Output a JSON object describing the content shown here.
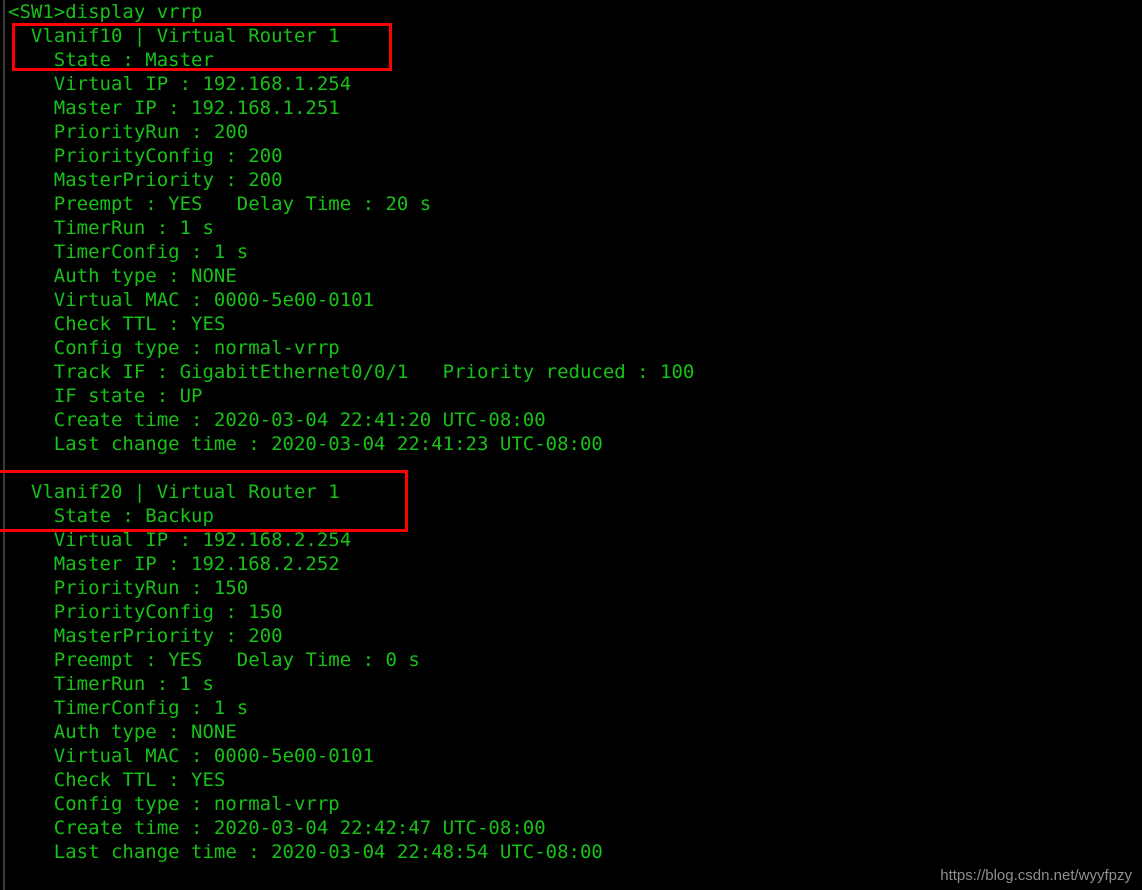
{
  "terminal": {
    "background_color": "#000000",
    "text_color": "#18c018",
    "highlight_color": "#ff0000",
    "watermark_color": "#8e8e8e",
    "prompt": "<SW1>display vrrp",
    "lines": [
      "<SW1>display vrrp",
      "  Vlanif10 | Virtual Router 1",
      "    State : Master",
      "    Virtual IP : 192.168.1.254",
      "    Master IP : 192.168.1.251",
      "    PriorityRun : 200",
      "    PriorityConfig : 200",
      "    MasterPriority : 200",
      "    Preempt : YES   Delay Time : 20 s",
      "    TimerRun : 1 s",
      "    TimerConfig : 1 s",
      "    Auth type : NONE",
      "    Virtual MAC : 0000-5e00-0101",
      "    Check TTL : YES",
      "    Config type : normal-vrrp",
      "    Track IF : GigabitEthernet0/0/1   Priority reduced : 100",
      "    IF state : UP",
      "    Create time : 2020-03-04 22:41:20 UTC-08:00",
      "    Last change time : 2020-03-04 22:41:23 UTC-08:00",
      "",
      "  Vlanif20 | Virtual Router 1",
      "    State : Backup",
      "    Virtual IP : 192.168.2.254",
      "    Master IP : 192.168.2.252",
      "    PriorityRun : 150",
      "    PriorityConfig : 150",
      "    MasterPriority : 200",
      "    Preempt : YES   Delay Time : 0 s",
      "    TimerRun : 1 s",
      "    TimerConfig : 1 s",
      "    Auth type : NONE",
      "    Virtual MAC : 0000-5e00-0101",
      "    Check TTL : YES",
      "    Config type : normal-vrrp",
      "    Create time : 2020-03-04 22:42:47 UTC-08:00",
      "    Last change time : 2020-03-04 22:48:54 UTC-08:00"
    ],
    "vrrp_groups": [
      {
        "interface": "Vlanif10",
        "virtual_router": "1",
        "header": "Vlanif10 | Virtual Router 1",
        "state": "Master",
        "virtual_ip": "192.168.1.254",
        "master_ip": "192.168.1.251",
        "priority_run": "200",
        "priority_config": "200",
        "master_priority": "200",
        "preempt": "YES",
        "delay_time": "20 s",
        "timer_run": "1 s",
        "timer_config": "1 s",
        "auth_type": "NONE",
        "virtual_mac": "0000-5e00-0101",
        "check_ttl": "YES",
        "config_type": "normal-vrrp",
        "track_if": "GigabitEthernet0/0/1",
        "priority_reduced": "100",
        "if_state": "UP",
        "create_time": "2020-03-04 22:41:20 UTC-08:00",
        "last_change_time": "2020-03-04 22:41:23 UTC-08:00"
      },
      {
        "interface": "Vlanif20",
        "virtual_router": "1",
        "header": "Vlanif20 | Virtual Router 1",
        "state": "Backup",
        "virtual_ip": "192.168.2.254",
        "master_ip": "192.168.2.252",
        "priority_run": "150",
        "priority_config": "150",
        "master_priority": "200",
        "preempt": "YES",
        "delay_time": "0 s",
        "timer_run": "1 s",
        "timer_config": "1 s",
        "auth_type": "NONE",
        "virtual_mac": "0000-5e00-0101",
        "check_ttl": "YES",
        "config_type": "normal-vrrp",
        "create_time": "2020-03-04 22:42:47 UTC-08:00",
        "last_change_time": "2020-03-04 22:48:54 UTC-08:00"
      }
    ]
  },
  "annotations": {
    "highlight_1_label": "Vlanif10 Master state highlight",
    "highlight_2_label": "Vlanif20 Backup state highlight"
  },
  "watermark": {
    "text": "https://blog.csdn.net/wyyfpzy"
  }
}
